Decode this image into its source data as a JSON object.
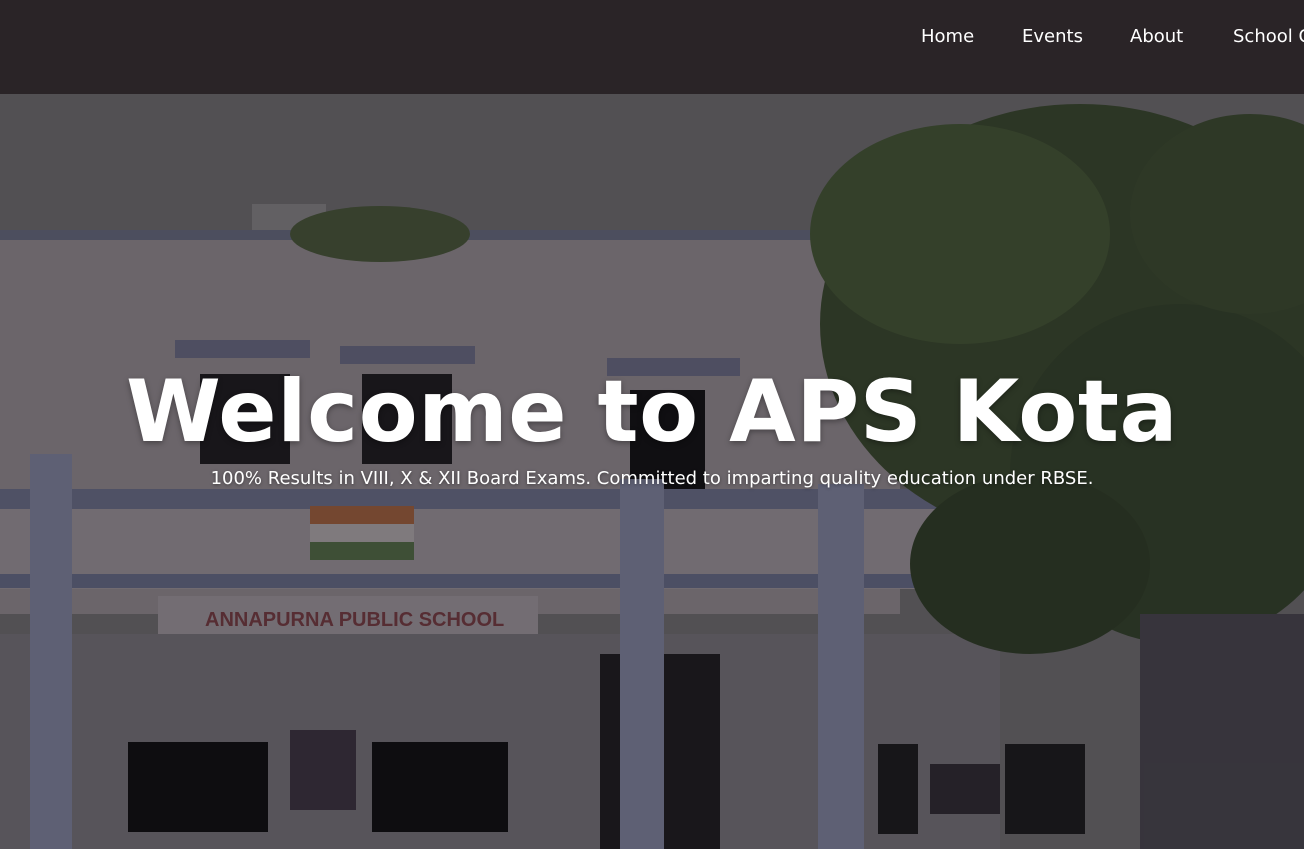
{
  "nav": {
    "items": [
      {
        "label": "Home"
      },
      {
        "label": "Events"
      },
      {
        "label": "About"
      },
      {
        "label": "School C"
      }
    ]
  },
  "hero": {
    "title": "Welcome to APS Kota",
    "subtitle": "100% Results in VIII, X & XII Board Exams. Committed to imparting quality education under RBSE.",
    "background_image": {
      "description": "school building facade with flag and tree",
      "sign_text": "ANNAPURNA PUBLIC SCHOOL"
    }
  },
  "colors": {
    "nav_background": "#2a2427",
    "nav_text": "#ffffff",
    "hero_text": "#ffffff"
  }
}
